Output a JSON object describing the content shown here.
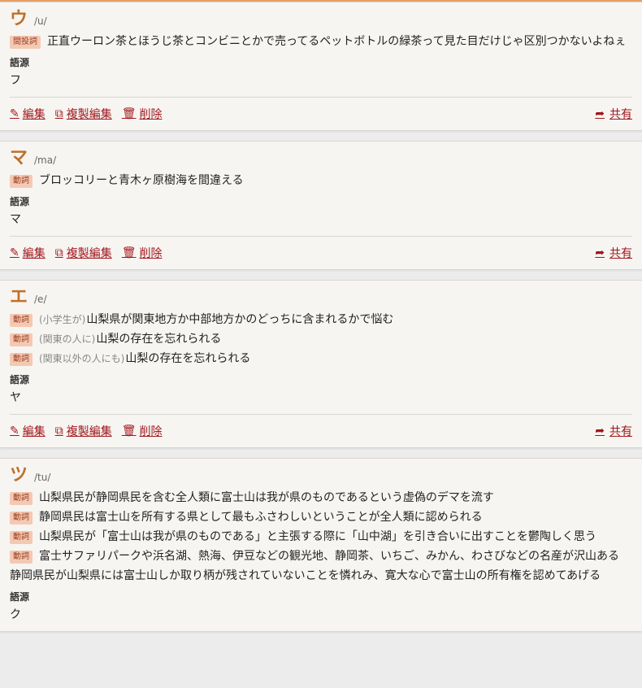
{
  "actions": {
    "edit": "編集",
    "copy_edit": "複製編集",
    "delete": "削除",
    "share": "共有"
  },
  "etymology_label": "語源",
  "entries": [
    {
      "word": "ウ",
      "pron": "/u/",
      "senses": [
        {
          "pos": "間投詞",
          "ctx": "",
          "text": "正直ウーロン茶とほうじ茶とコンビニとかで売ってるペットボトルの緑茶って見た目だけじゃ区別つかないよねぇ"
        }
      ],
      "etymology": "フ"
    },
    {
      "word": "マ",
      "pron": "/ma/",
      "senses": [
        {
          "pos": "動詞",
          "ctx": "",
          "text": "ブロッコリーと青木ヶ原樹海を間違える"
        }
      ],
      "etymology": "マ"
    },
    {
      "word": "エ",
      "pron": "/e/",
      "senses": [
        {
          "pos": "動詞",
          "ctx": "(小学生が)",
          "text": "山梨県が関東地方か中部地方かのどっちに含まれるかで悩む"
        },
        {
          "pos": "動詞",
          "ctx": "(関東の人に)",
          "text": "山梨の存在を忘れられる"
        },
        {
          "pos": "動詞",
          "ctx": "(関東以外の人にも)",
          "text": "山梨の存在を忘れられる"
        }
      ],
      "etymology": "ヤ"
    },
    {
      "word": "ツ",
      "pron": "/tu/",
      "senses": [
        {
          "pos": "動詞",
          "ctx": "",
          "text": "山梨県民が静岡県民を含む全人類に富士山は我が県のものであるという虚偽のデマを流す"
        },
        {
          "pos": "動詞",
          "ctx": "",
          "text": "静岡県民は富士山を所有する県として最もふさわしいということが全人類に認められる"
        },
        {
          "pos": "動詞",
          "ctx": "",
          "text": "山梨県民が「富士山は我が県のものである」と主張する際に「山中湖」を引き合いに出すことを鬱陶しく思う"
        },
        {
          "pos": "動詞",
          "ctx": "",
          "text": "富士サファリパークや浜名湖、熱海、伊豆などの観光地、静岡茶、いちご、みかん、わさびなどの名産が沢山ある"
        }
      ],
      "extra_text": "静岡県民が山梨県には富士山しか取り柄が残されていないことを憐れみ、寛大な心で富士山の所有権を認めてあげる",
      "etymology": "ク"
    }
  ],
  "colors": {
    "accent": "#c0702a",
    "link": "#a0171c",
    "pos_bg": "#f4c9b3"
  }
}
